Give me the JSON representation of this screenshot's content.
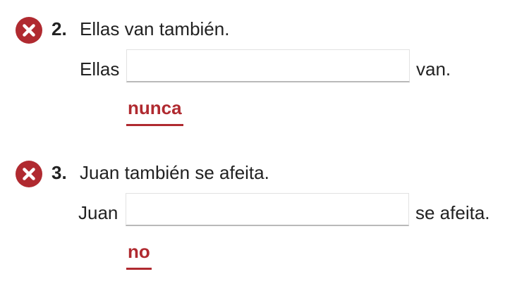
{
  "colors": {
    "error_red": "#b02a30",
    "text": "#222222",
    "input_border": "#e2e2e2",
    "input_underline": "#b9b9b9"
  },
  "items": [
    {
      "number": "2.",
      "prompt": "Ellas van también.",
      "before_blank": "Ellas",
      "input_value": "",
      "after_blank": "van.",
      "correct_answer": "nunca",
      "status_icon": "x-circle-icon"
    },
    {
      "number": "3.",
      "prompt": "Juan también se afeita.",
      "before_blank": "Juan",
      "input_value": "",
      "after_blank": "se afeita.",
      "correct_answer": "no",
      "status_icon": "x-circle-icon"
    }
  ]
}
